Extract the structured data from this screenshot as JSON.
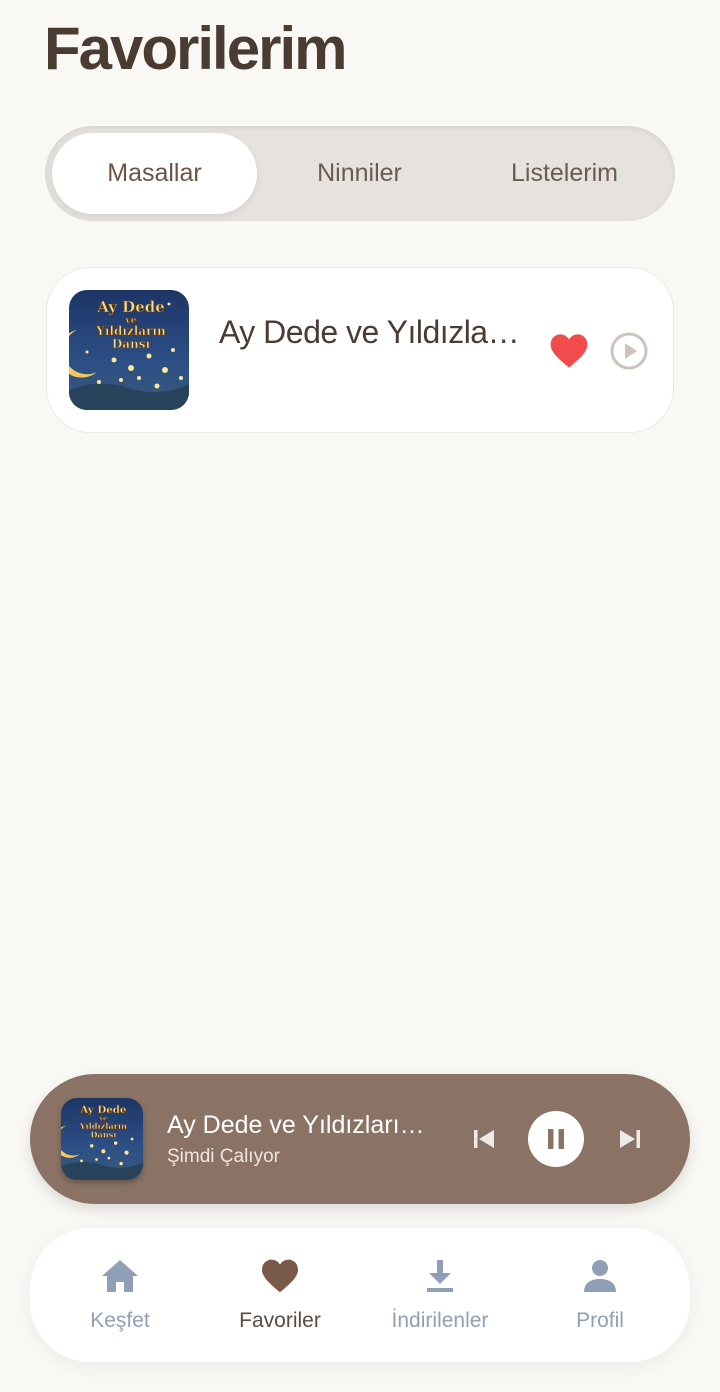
{
  "header": {
    "title": "Favorilerim"
  },
  "tabs": [
    {
      "label": "Masallar",
      "active": true
    },
    {
      "label": "Ninniler",
      "active": false
    },
    {
      "label": "Listelerim",
      "active": false
    }
  ],
  "favorites": [
    {
      "title": "Ay Dede ve Yıldızların Dansı",
      "cover_text": [
        "Ay Dede",
        "ve",
        "Yıldızların",
        "Dansı"
      ],
      "liked": true
    }
  ],
  "now_playing": {
    "title": "Ay Dede ve Yıldızların Dansı",
    "status": "Şimdi Çalıyor",
    "cover_text": [
      "Ay Dede",
      "ve",
      "Yıldızların",
      "Dansı"
    ]
  },
  "bottom_nav": [
    {
      "label": "Keşfet",
      "icon": "home-icon",
      "active": false
    },
    {
      "label": "Favoriler",
      "icon": "heart-icon",
      "active": true
    },
    {
      "label": "İndirilenler",
      "icon": "download-icon",
      "active": false
    },
    {
      "label": "Profil",
      "icon": "person-icon",
      "active": false
    }
  ],
  "colors": {
    "background": "#faf8f5",
    "accent_brown": "#8a7364",
    "heart_red": "#f24b4b",
    "nav_inactive": "#8fa0b6",
    "nav_active": "#5a4a40"
  }
}
